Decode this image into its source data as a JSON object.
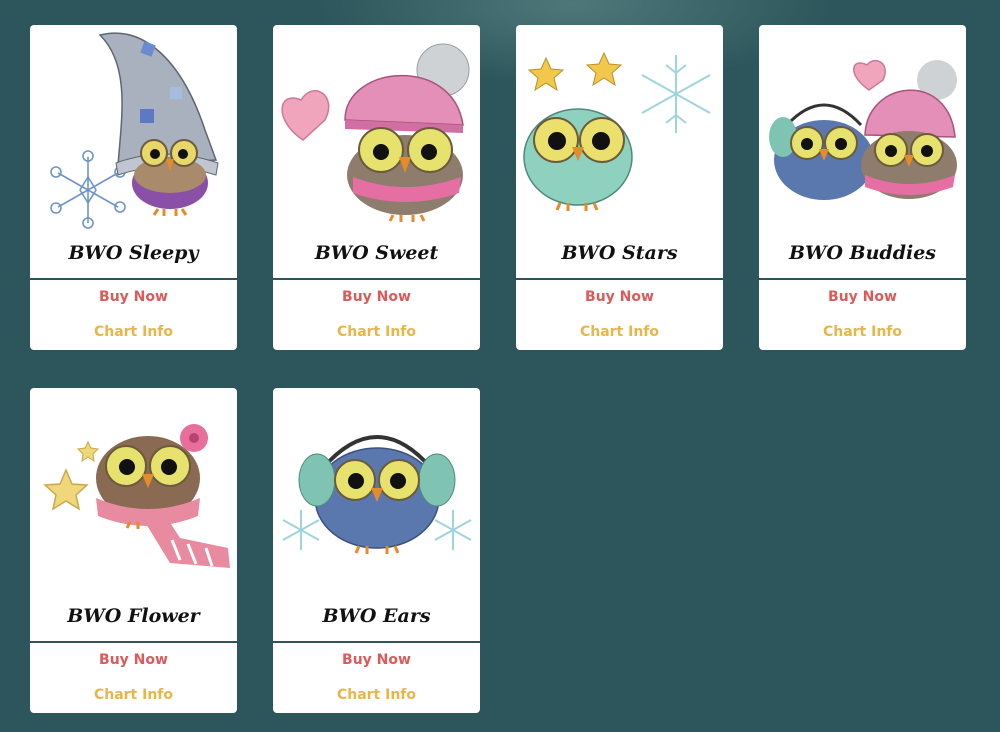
{
  "products": [
    {
      "title": "BWO Sleepy",
      "buy_label": "Buy Now",
      "chart_label": "Chart Info",
      "image": "owl-sleepy-icon"
    },
    {
      "title": "BWO Sweet",
      "buy_label": "Buy Now",
      "chart_label": "Chart Info",
      "image": "owl-sweet-icon"
    },
    {
      "title": "BWO Stars",
      "buy_label": "Buy Now",
      "chart_label": "Chart Info",
      "image": "owl-stars-icon"
    },
    {
      "title": "BWO Buddies",
      "buy_label": "Buy Now",
      "chart_label": "Chart Info",
      "image": "owl-buddies-icon"
    },
    {
      "title": "BWO Flower",
      "buy_label": "Buy Now",
      "chart_label": "Chart Info",
      "image": "owl-flower-icon"
    },
    {
      "title": "BWO Ears",
      "buy_label": "Buy Now",
      "chart_label": "Chart Info",
      "image": "owl-ears-icon"
    }
  ],
  "colors": {
    "background": "#2c565b",
    "buy_now": "#dd5a5a",
    "chart_info": "#e8b54a",
    "card": "#ffffff"
  }
}
